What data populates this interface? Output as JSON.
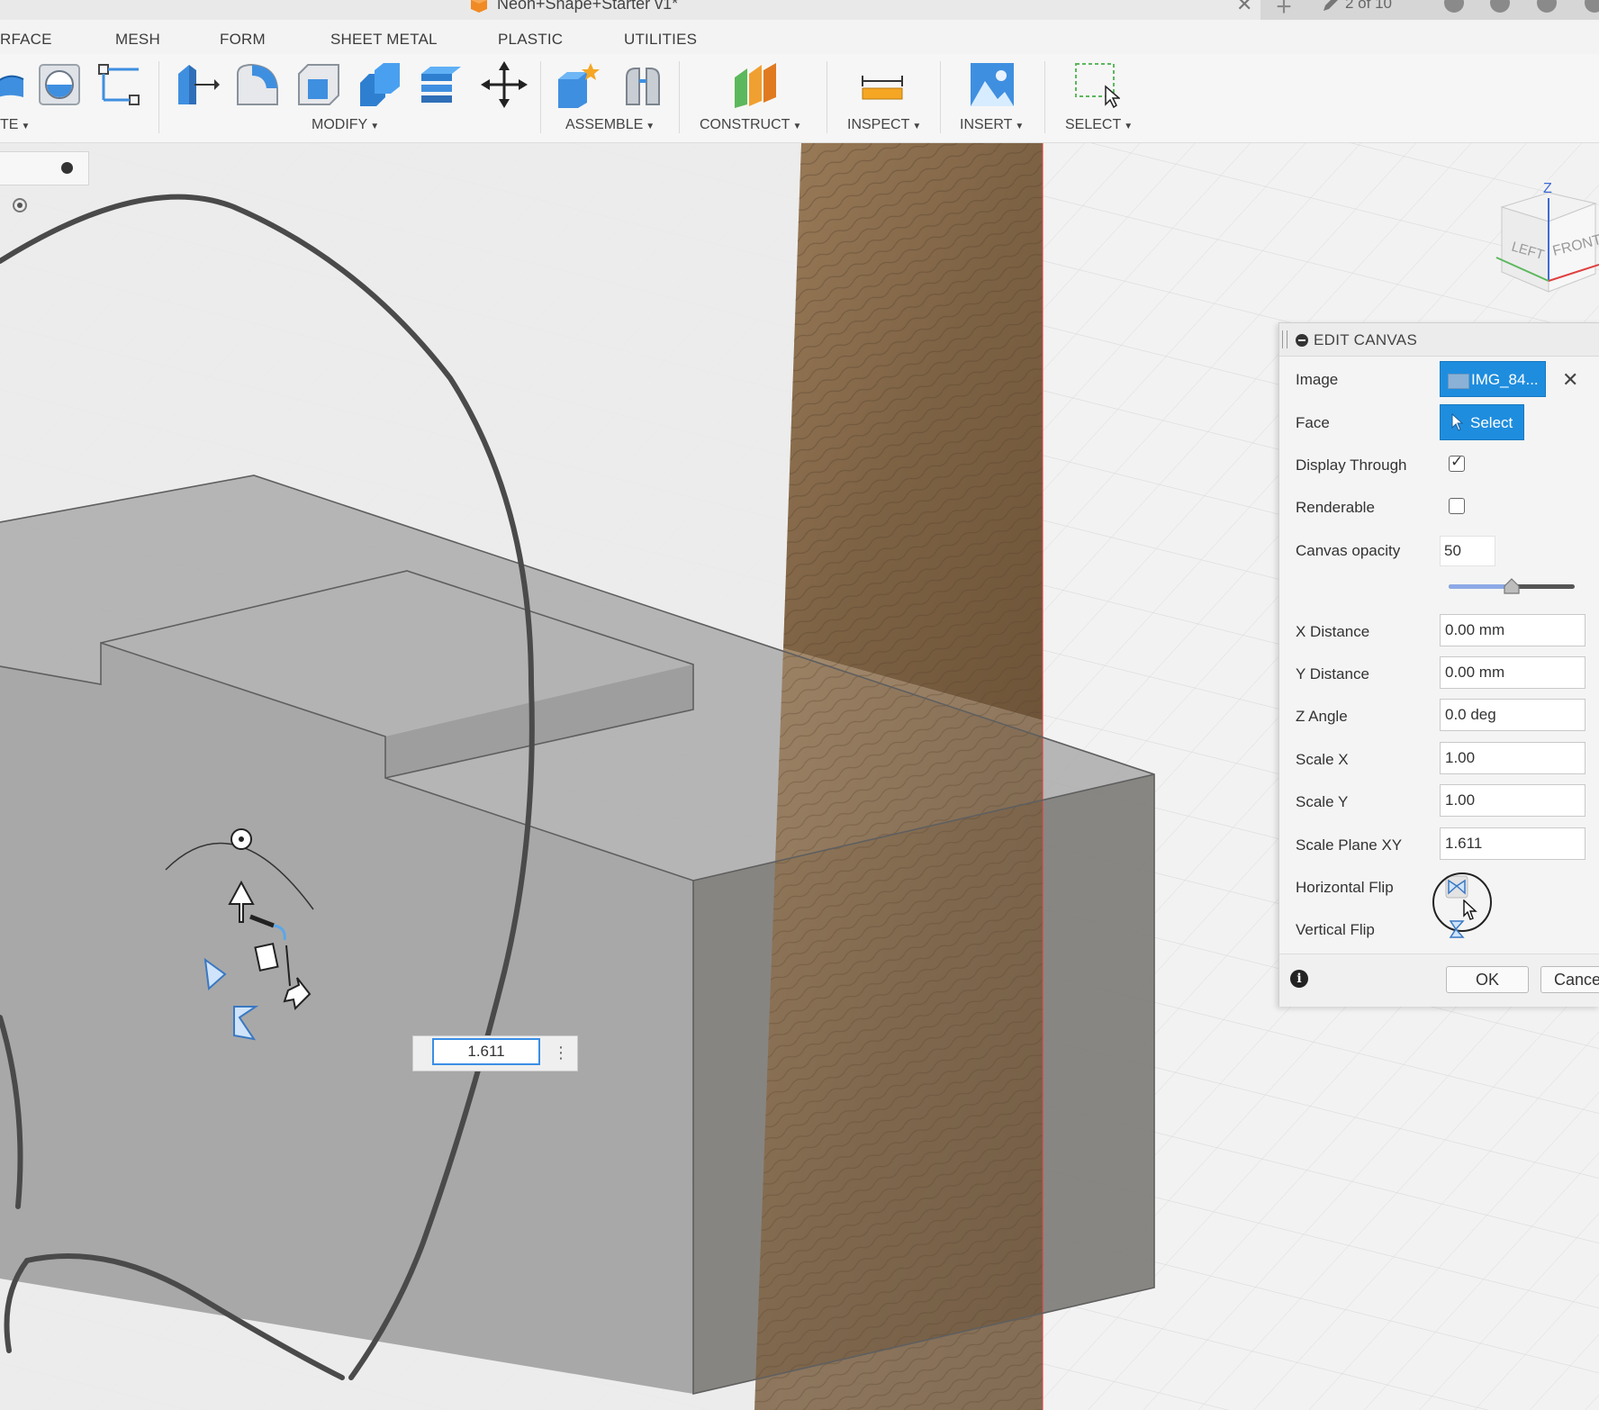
{
  "window": {
    "document_title": "Neon+Shape+Starter v1*",
    "tab_close": "✕",
    "new_tab": "+",
    "jobs_status": "2 of 10"
  },
  "tabs": [
    "RFACE",
    "MESH",
    "FORM",
    "SHEET METAL",
    "PLASTIC",
    "UTILITIES"
  ],
  "toolbar": {
    "groups": [
      "TE",
      "MODIFY",
      "ASSEMBLE",
      "CONSTRUCT",
      "INSPECT",
      "INSERT",
      "SELECT"
    ]
  },
  "viewport": {
    "scale_value": "1.611",
    "more_options": "⋮",
    "viewcube": {
      "top": "Z",
      "left_face": "LEFT",
      "front_face": "FRONT"
    }
  },
  "edit_canvas": {
    "title": "EDIT CANVAS",
    "image_label": "Image",
    "image_value": "IMG_84...",
    "clear": "✕",
    "face_label": "Face",
    "face_button": "Select",
    "display_through_label": "Display Through",
    "display_through_checked": true,
    "renderable_label": "Renderable",
    "renderable_checked": false,
    "canvas_opacity_label": "Canvas opacity",
    "canvas_opacity_value": "50",
    "x_distance_label": "X Distance",
    "x_distance_value": "0.00 mm",
    "y_distance_label": "Y Distance",
    "y_distance_value": "0.00 mm",
    "z_angle_label": "Z Angle",
    "z_angle_value": "0.0 deg",
    "scale_x_label": "Scale X",
    "scale_x_value": "1.00",
    "scale_y_label": "Scale Y",
    "scale_y_value": "1.00",
    "scale_plane_xy_label": "Scale Plane XY",
    "scale_plane_xy_value": "1.611",
    "horizontal_flip_label": "Horizontal Flip",
    "vertical_flip_label": "Vertical Flip",
    "info": "i",
    "ok_label": "OK",
    "cancel_label": "Cancel"
  },
  "colors": {
    "accent_blue": "#1f8dde",
    "wood_plane": "#8a6d4c",
    "body_gray": "#8e8e8e",
    "origin_red": "#e04040"
  }
}
